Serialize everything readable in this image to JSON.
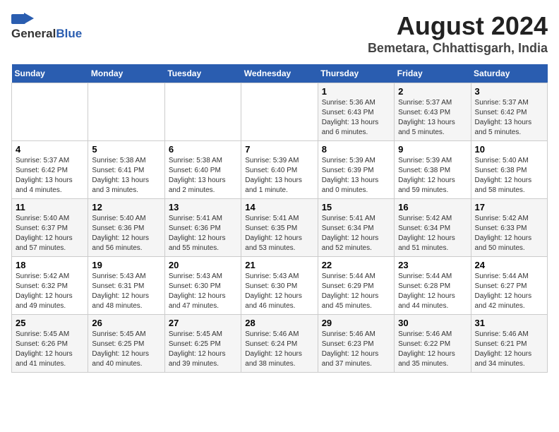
{
  "logo": {
    "general": "General",
    "blue": "Blue"
  },
  "title": "August 2024",
  "subtitle": "Bemetara, Chhattisgarh, India",
  "weekdays": [
    "Sunday",
    "Monday",
    "Tuesday",
    "Wednesday",
    "Thursday",
    "Friday",
    "Saturday"
  ],
  "weeks": [
    [
      {
        "day": "",
        "detail": ""
      },
      {
        "day": "",
        "detail": ""
      },
      {
        "day": "",
        "detail": ""
      },
      {
        "day": "",
        "detail": ""
      },
      {
        "day": "1",
        "detail": "Sunrise: 5:36 AM\nSunset: 6:43 PM\nDaylight: 13 hours\nand 6 minutes."
      },
      {
        "day": "2",
        "detail": "Sunrise: 5:37 AM\nSunset: 6:43 PM\nDaylight: 13 hours\nand 5 minutes."
      },
      {
        "day": "3",
        "detail": "Sunrise: 5:37 AM\nSunset: 6:42 PM\nDaylight: 13 hours\nand 5 minutes."
      }
    ],
    [
      {
        "day": "4",
        "detail": "Sunrise: 5:37 AM\nSunset: 6:42 PM\nDaylight: 13 hours\nand 4 minutes."
      },
      {
        "day": "5",
        "detail": "Sunrise: 5:38 AM\nSunset: 6:41 PM\nDaylight: 13 hours\nand 3 minutes."
      },
      {
        "day": "6",
        "detail": "Sunrise: 5:38 AM\nSunset: 6:40 PM\nDaylight: 13 hours\nand 2 minutes."
      },
      {
        "day": "7",
        "detail": "Sunrise: 5:39 AM\nSunset: 6:40 PM\nDaylight: 13 hours\nand 1 minute."
      },
      {
        "day": "8",
        "detail": "Sunrise: 5:39 AM\nSunset: 6:39 PM\nDaylight: 13 hours\nand 0 minutes."
      },
      {
        "day": "9",
        "detail": "Sunrise: 5:39 AM\nSunset: 6:38 PM\nDaylight: 12 hours\nand 59 minutes."
      },
      {
        "day": "10",
        "detail": "Sunrise: 5:40 AM\nSunset: 6:38 PM\nDaylight: 12 hours\nand 58 minutes."
      }
    ],
    [
      {
        "day": "11",
        "detail": "Sunrise: 5:40 AM\nSunset: 6:37 PM\nDaylight: 12 hours\nand 57 minutes."
      },
      {
        "day": "12",
        "detail": "Sunrise: 5:40 AM\nSunset: 6:36 PM\nDaylight: 12 hours\nand 56 minutes."
      },
      {
        "day": "13",
        "detail": "Sunrise: 5:41 AM\nSunset: 6:36 PM\nDaylight: 12 hours\nand 55 minutes."
      },
      {
        "day": "14",
        "detail": "Sunrise: 5:41 AM\nSunset: 6:35 PM\nDaylight: 12 hours\nand 53 minutes."
      },
      {
        "day": "15",
        "detail": "Sunrise: 5:41 AM\nSunset: 6:34 PM\nDaylight: 12 hours\nand 52 minutes."
      },
      {
        "day": "16",
        "detail": "Sunrise: 5:42 AM\nSunset: 6:34 PM\nDaylight: 12 hours\nand 51 minutes."
      },
      {
        "day": "17",
        "detail": "Sunrise: 5:42 AM\nSunset: 6:33 PM\nDaylight: 12 hours\nand 50 minutes."
      }
    ],
    [
      {
        "day": "18",
        "detail": "Sunrise: 5:42 AM\nSunset: 6:32 PM\nDaylight: 12 hours\nand 49 minutes."
      },
      {
        "day": "19",
        "detail": "Sunrise: 5:43 AM\nSunset: 6:31 PM\nDaylight: 12 hours\nand 48 minutes."
      },
      {
        "day": "20",
        "detail": "Sunrise: 5:43 AM\nSunset: 6:30 PM\nDaylight: 12 hours\nand 47 minutes."
      },
      {
        "day": "21",
        "detail": "Sunrise: 5:43 AM\nSunset: 6:30 PM\nDaylight: 12 hours\nand 46 minutes."
      },
      {
        "day": "22",
        "detail": "Sunrise: 5:44 AM\nSunset: 6:29 PM\nDaylight: 12 hours\nand 45 minutes."
      },
      {
        "day": "23",
        "detail": "Sunrise: 5:44 AM\nSunset: 6:28 PM\nDaylight: 12 hours\nand 44 minutes."
      },
      {
        "day": "24",
        "detail": "Sunrise: 5:44 AM\nSunset: 6:27 PM\nDaylight: 12 hours\nand 42 minutes."
      }
    ],
    [
      {
        "day": "25",
        "detail": "Sunrise: 5:45 AM\nSunset: 6:26 PM\nDaylight: 12 hours\nand 41 minutes."
      },
      {
        "day": "26",
        "detail": "Sunrise: 5:45 AM\nSunset: 6:25 PM\nDaylight: 12 hours\nand 40 minutes."
      },
      {
        "day": "27",
        "detail": "Sunrise: 5:45 AM\nSunset: 6:25 PM\nDaylight: 12 hours\nand 39 minutes."
      },
      {
        "day": "28",
        "detail": "Sunrise: 5:46 AM\nSunset: 6:24 PM\nDaylight: 12 hours\nand 38 minutes."
      },
      {
        "day": "29",
        "detail": "Sunrise: 5:46 AM\nSunset: 6:23 PM\nDaylight: 12 hours\nand 37 minutes."
      },
      {
        "day": "30",
        "detail": "Sunrise: 5:46 AM\nSunset: 6:22 PM\nDaylight: 12 hours\nand 35 minutes."
      },
      {
        "day": "31",
        "detail": "Sunrise: 5:46 AM\nSunset: 6:21 PM\nDaylight: 12 hours\nand 34 minutes."
      }
    ]
  ]
}
